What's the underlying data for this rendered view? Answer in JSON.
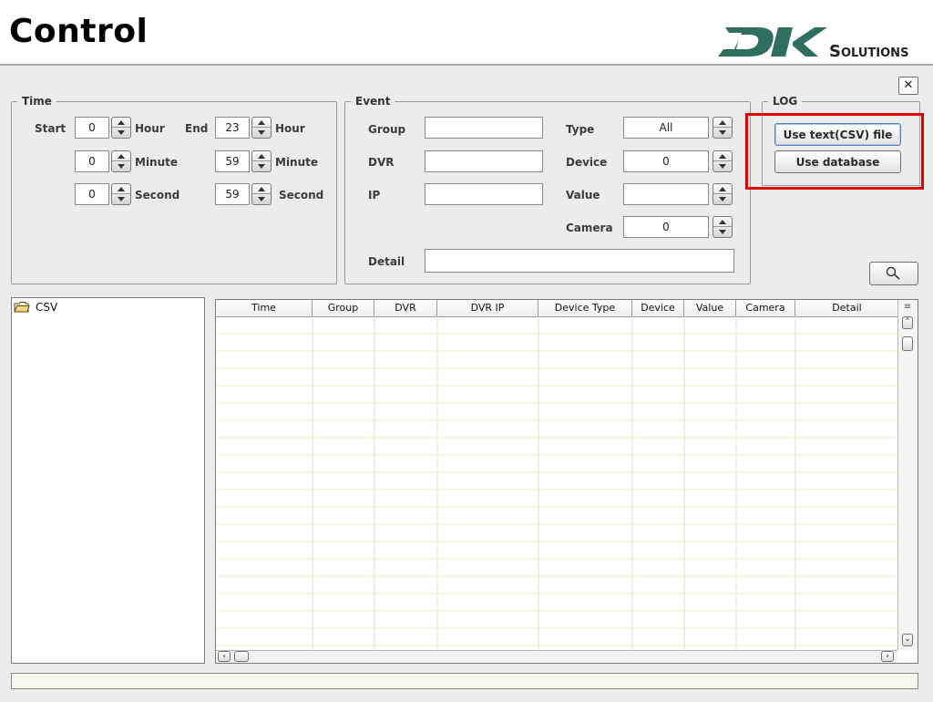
{
  "header": {
    "title": "Control",
    "logo_text": "DK SOLUTIONS"
  },
  "time": {
    "legend": "Time",
    "start_label": "Start",
    "end_label": "End",
    "start_hour": "0",
    "start_minute": "0",
    "start_second": "0",
    "end_hour": "23",
    "end_minute": "59",
    "end_second": "59",
    "hour_label": "Hour",
    "minute_label": "Minute",
    "second_label": "Second"
  },
  "event": {
    "legend": "Event",
    "group_label": "Group",
    "dvr_label": "DVR",
    "ip_label": "IP",
    "detail_label": "Detail",
    "type_label": "Type",
    "device_label": "Device",
    "value_label": "Value",
    "camera_label": "Camera",
    "group_value": "",
    "dvr_value": "",
    "ip_value": "",
    "detail_value": "",
    "type_value": "All",
    "device_value": "0",
    "value_value": "",
    "camera_value": "0"
  },
  "log": {
    "legend": "LOG",
    "csv_button": "Use text(CSV) file",
    "db_button": "Use database"
  },
  "csv_panel": {
    "folder_label": "CSV"
  },
  "table": {
    "columns": [
      "Time",
      "Group",
      "DVR",
      "DVR IP",
      "Device Type",
      "Device",
      "Value",
      "Camera",
      "Detail"
    ]
  },
  "colors": {
    "annotation": "#e00000",
    "window_bg": "#ececec"
  },
  "icons": [
    "close-icon",
    "search-icon",
    "folder-icon",
    "spinner-up-icon",
    "spinner-down-icon"
  ]
}
